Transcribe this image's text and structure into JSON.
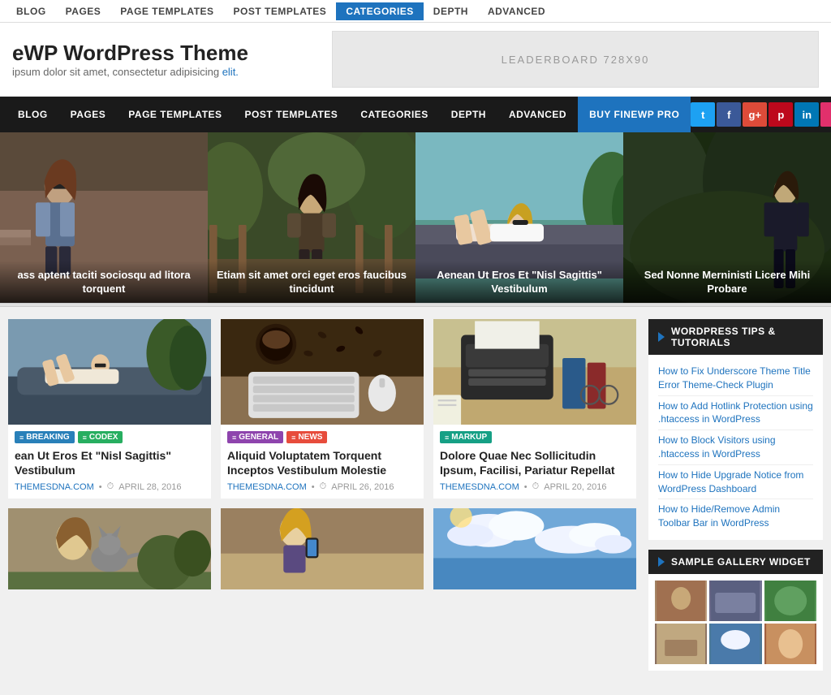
{
  "adminBar": {
    "tabs": [
      "BLOG",
      "PAGES",
      "PAGE TEMPLATES",
      "POST TEMPLATES",
      "CATEGORIES",
      "DEPTH",
      "ADVANCED"
    ],
    "activeTab": "CATEGORIES"
  },
  "header": {
    "siteTitle": "eWP WordPress Theme",
    "tagline": "ipsum dolor sit amet, consectetur adipisicing elit.",
    "adLabel": "LEADERBOARD 728X90"
  },
  "mainNav": {
    "items": [
      "BLOG",
      "PAGES",
      "PAGE TEMPLATES",
      "POST TEMPLATES",
      "CATEGORIES",
      "DEPTH",
      "ADVANCED",
      "BUY FINEWP PRO"
    ],
    "buyPro": "BUY FINEWP PRO",
    "socialIcons": [
      {
        "name": "twitter",
        "color": "#1da1f2",
        "symbol": "t"
      },
      {
        "name": "facebook",
        "color": "#3b5998",
        "symbol": "f"
      },
      {
        "name": "google-plus",
        "color": "#dd4b39",
        "symbol": "g+"
      },
      {
        "name": "pinterest",
        "color": "#bd081c",
        "symbol": "p"
      },
      {
        "name": "linkedin",
        "color": "#0077b5",
        "symbol": "in"
      },
      {
        "name": "instagram",
        "color": "#e1306c",
        "symbol": "i"
      },
      {
        "name": "youtube",
        "color": "#ff0000",
        "symbol": "▶"
      },
      {
        "name": "email",
        "color": "#888",
        "symbol": "✉"
      },
      {
        "name": "rss",
        "color": "#f26522",
        "symbol": "◉"
      }
    ]
  },
  "heroSlides": [
    {
      "title": "ass aptent taciti sociosqu ad litora torquent",
      "bgClass": "slide-bg-1"
    },
    {
      "title": "Etiam sit amet orci eget eros faucibus tincidunt",
      "bgClass": "slide-bg-2"
    },
    {
      "title": "Aenean Ut Eros Et \"Nisl Sagittis\" Vestibulum",
      "bgClass": "slide-bg-3"
    },
    {
      "title": "Sed Nonne Merninisti Licere Mihi Probare",
      "bgClass": "slide-bg-4"
    }
  ],
  "posts": [
    {
      "tags": [
        "BREAKING",
        "CODEX"
      ],
      "title": "ean Ut Eros Et \"Nisl Sagittis\" Vestibulum",
      "site": "THEMESDNA.COM",
      "date": "APRIL 28, 2016",
      "thumbClass": "thumb-1"
    },
    {
      "tags": [
        "GENERAL",
        "NEWS"
      ],
      "title": "Aliquid Voluptatem Torquent Inceptos Vestibulum Molestie",
      "site": "THEMESDNA.COM",
      "date": "APRIL 26, 2016",
      "thumbClass": "thumb-2"
    },
    {
      "tags": [
        "MARKUP"
      ],
      "title": "Dolore Quae Nec Sollicitudin Ipsum, Facilisi, Pariatur Repellat",
      "site": "THEMESDNA.COM",
      "date": "APRIL 20, 2016",
      "thumbClass": "thumb-3"
    }
  ],
  "postsRow2": [
    {
      "thumbClass": "thumb-4"
    },
    {
      "thumbClass": "thumb-2"
    },
    {
      "thumbClass": "thumb-5"
    }
  ],
  "sidebar": {
    "widgets": [
      {
        "title": "WORDPRESS TIPS & TUTORIALS",
        "links": [
          "How to Fix Underscore Theme Title Error Theme-Check Plugin",
          "How to Add Hotlink Protection using .htaccess in WordPress",
          "How to Block Visitors using .htaccess in WordPress",
          "How to Hide Upgrade Notice from WordPress Dashboard",
          "How to Hide/Remove Admin Toolbar Bar in WordPress"
        ]
      },
      {
        "title": "SAMPLE GALLERY WIDGET",
        "links": []
      }
    ]
  }
}
